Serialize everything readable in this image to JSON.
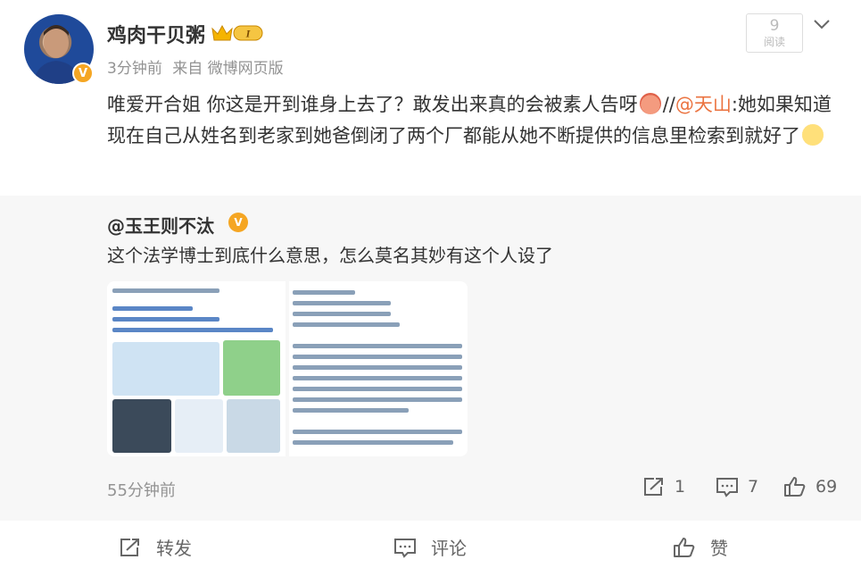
{
  "post": {
    "author": "鸡肉干贝粥",
    "vip_level": "I",
    "time": "3分钟前",
    "source": "来自 微博网页版",
    "read_count": "9",
    "read_label": "阅读",
    "text_part1": "唯爱开合姐 你这是开到谁身上去了？敢发出来真的会被素人告呀",
    "slash": "//",
    "mention": "@天山",
    "text_part2": ":她如果知道现在自己从姓名到老家到她爸倒闭了两个厂都能从她不断提供的信息里检索到就好了",
    "emoji1": "angry-face-icon",
    "emoji2": "wink-face-icon"
  },
  "retweet": {
    "author": "@玉王则不汰",
    "text": "这个法学博士到底什么意思，怎么莫名其妙有这个人设了",
    "time": "55分钟前",
    "repost_count": "1",
    "comment_count": "7",
    "like_count": "69"
  },
  "actions": {
    "repost": "转发",
    "comment": "评论",
    "like": "赞"
  },
  "colors": {
    "mention": "#eb7340",
    "retweet_bg": "#f7f7f7",
    "badge": "#f5a623"
  }
}
